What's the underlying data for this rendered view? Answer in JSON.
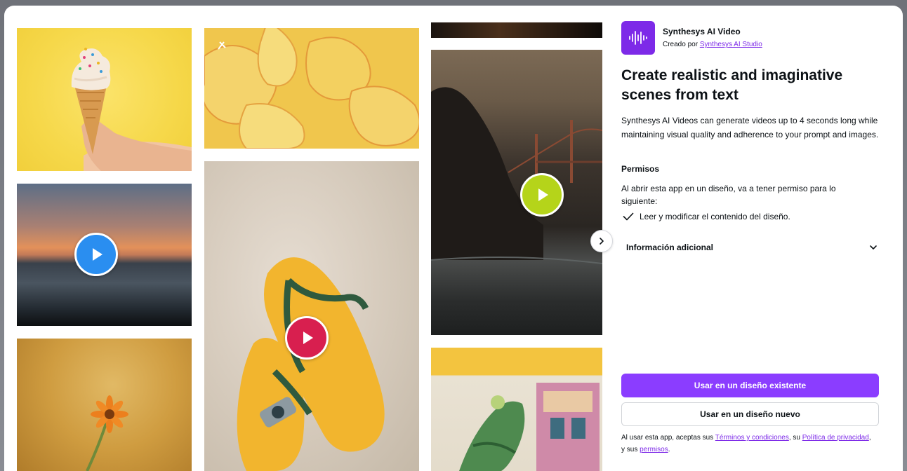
{
  "app": {
    "name": "Synthesys AI Video",
    "created_by_prefix": "Creado por",
    "created_by_link": "Synthesys AI Studio",
    "icon": "waveform-icon"
  },
  "headline": "Create realistic and imaginative scenes from text",
  "description": "Synthesys AI Videos can generate videos up to 4 seconds long while maintaining visual quality and adherence to your prompt and images.",
  "permissions": {
    "title": "Permisos",
    "intro": "Al abrir esta app en un diseño, va a tener permiso para lo siguiente:",
    "items": [
      "Leer y modificar el contenido del diseño."
    ]
  },
  "additional_info": {
    "label": "Información adicional"
  },
  "buttons": {
    "use_existing": "Usar en un diseño existente",
    "use_new": "Usar en un diseño nuevo"
  },
  "legal": {
    "prefix": "Al usar esta app, aceptas sus ",
    "terms": "Términos y condiciones",
    "mid": ", su ",
    "privacy": "Política de privacidad",
    "mid2": ", y sus ",
    "perms": "permisos",
    "suffix": "."
  },
  "colors": {
    "accent": "#8b3dff",
    "play_blue": "#2a8ef0",
    "play_red": "#d81f4f",
    "play_lime": "#b5d41a"
  }
}
